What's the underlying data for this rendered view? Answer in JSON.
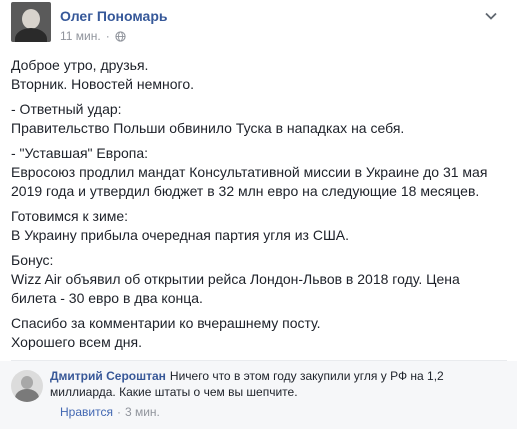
{
  "post": {
    "author": "Олег Пономарь",
    "time": "11 мин.",
    "paragraphs": [
      [
        "Доброе утро, друзья.",
        "Вторник. Новостей немного."
      ],
      [
        "- Ответный удар:",
        "Правительство Польши обвинило Туска в нападках на себя."
      ],
      [
        "- \"Уставшая\" Европа:",
        "Евросоюз продлил мандат Консультативной миссии в Украине до 31 мая",
        "2019 года и утвердил бюджет в 32 млн евро на следующие 18 месяцев."
      ],
      [
        "Готовимся к зиме:",
        "В Украину прибыла очередная партия угля из США."
      ],
      [
        "Бонус:",
        "Wizz Air объявил об открытии рейса Лондон-Львов в 2018 году. Цена",
        "билета - 30 евро в два конца."
      ],
      [
        "Спасибо за комментарии ко вчерашнему посту.",
        "Хорошего всем дня."
      ]
    ]
  },
  "comment": {
    "author": "Дмитрий Сероштан",
    "text_line1": "Ничего что в этом году закупили угля у РФ на 1,2",
    "text_line2": "миллиарда. Какие штаты о чем вы шепчите.",
    "like_label": "Нравится",
    "separator": "·",
    "time": "3 мин."
  },
  "icons": {
    "globe": "globe-icon",
    "chevron": "chevron-down-icon"
  },
  "colors": {
    "link": "#365899",
    "meta": "#90949c",
    "text": "#1d2129",
    "comment_bg": "#f6f7f9"
  }
}
